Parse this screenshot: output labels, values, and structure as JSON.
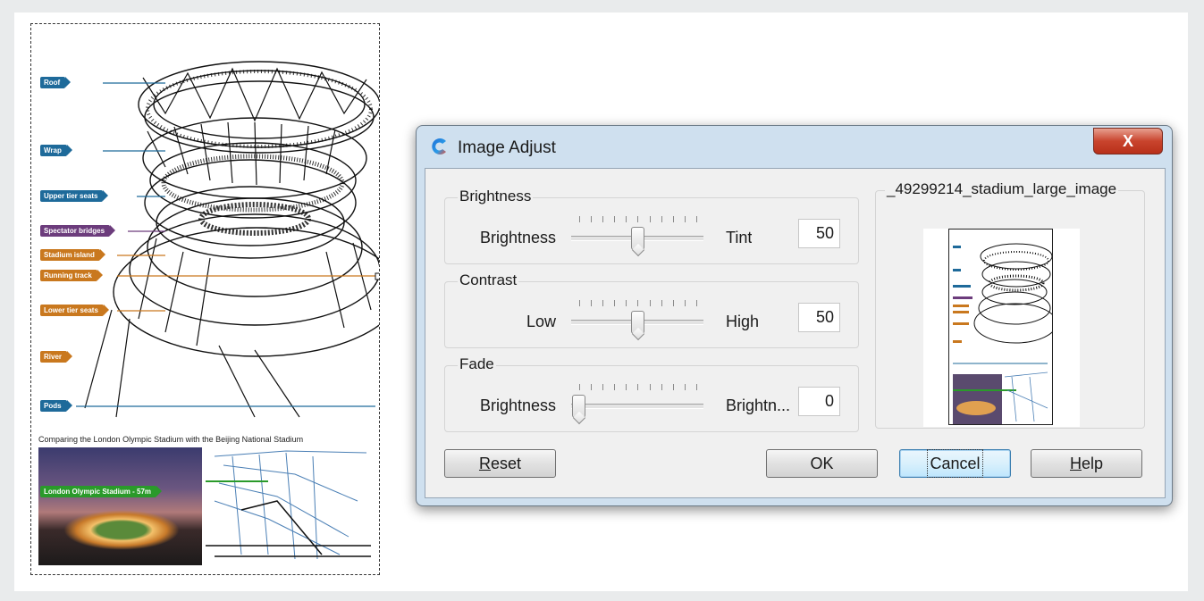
{
  "drawing": {
    "labels": [
      {
        "text": "Roof",
        "color": "#1e6a9a"
      },
      {
        "text": "Wrap",
        "color": "#1e6a9a"
      },
      {
        "text": "Upper tier seats",
        "color": "#1e6a9a"
      },
      {
        "text": "Spectator bridges",
        "color": "#6c3c7c"
      },
      {
        "text": "Stadium island",
        "color": "#c9781e"
      },
      {
        "text": "Running track",
        "color": "#c9781e"
      },
      {
        "text": "Lower tier seats",
        "color": "#c9781e"
      },
      {
        "text": "River",
        "color": "#c9781e"
      },
      {
        "text": "Pods",
        "color": "#1e6a9a"
      }
    ],
    "caption": "Comparing the London Olympic Stadium with the Beijing National Stadium",
    "photo_label": "London Olympic Stadium - 57m"
  },
  "dialog": {
    "title": "Image Adjust",
    "close_label": "X",
    "groups": [
      {
        "title": "Brightness",
        "left_label": "Brightness",
        "right_label": "Tint",
        "value": "50",
        "position": 0.5
      },
      {
        "title": "Contrast",
        "left_label": "Low",
        "right_label": "High",
        "value": "50",
        "position": 0.5
      },
      {
        "title": "Fade",
        "left_label": "Brightness",
        "right_label": "Brightn...",
        "value": "0",
        "position": 0.0
      }
    ],
    "preview_title": "_49299214_stadium_large_image",
    "buttons": {
      "reset": {
        "prefix": "",
        "mnemonic": "R",
        "rest": "eset"
      },
      "ok": {
        "label": "OK"
      },
      "cancel": {
        "label": "Cancel"
      },
      "help": {
        "prefix": "",
        "mnemonic": "H",
        "rest": "elp"
      }
    }
  },
  "colors": {
    "accent_blue": "#1e6a9a",
    "close_red": "#c9442d",
    "green_label": "#2a9a2a"
  }
}
